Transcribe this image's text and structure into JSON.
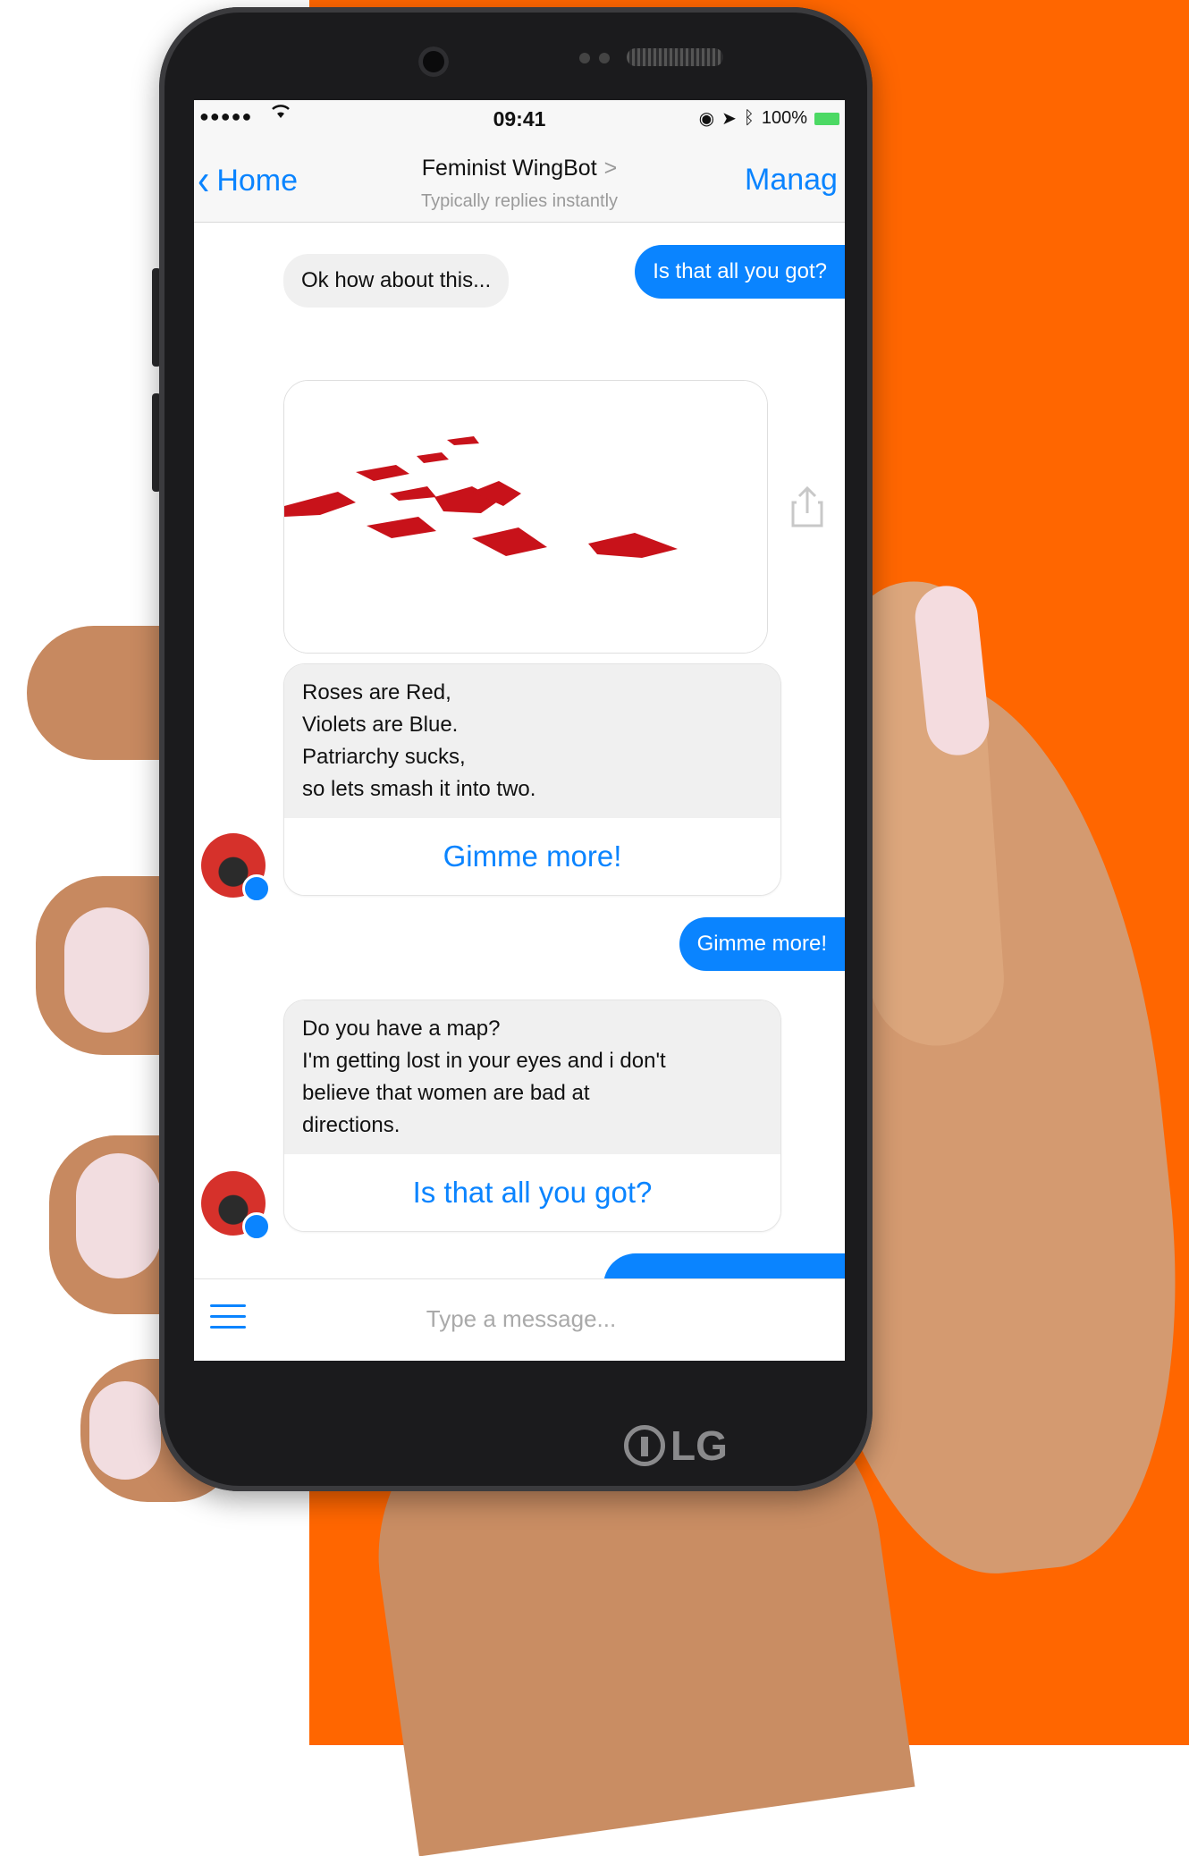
{
  "status_bar": {
    "signal": "●●●●●",
    "time": "09:41",
    "battery": "100%"
  },
  "header": {
    "back_label": "Home",
    "title": "Feminist WingBot",
    "title_arrow": ">",
    "subtitle": "Typically replies instantly",
    "manage_label": "Manag"
  },
  "messages": {
    "out1": "Is that all you got?",
    "in1": "Ok how about this...",
    "poem_lines": [
      "Roses are Red,",
      "Violets are Blue.",
      "Patriarchy sucks,",
      "so lets smash it into two."
    ],
    "poem_button": "Gimme more!",
    "out2": "Gimme more!",
    "pickup_lines": [
      "Do you have a map?",
      "I'm getting lost in your eyes and i don't",
      "believe that women are bad at",
      "directions."
    ],
    "pickup_button": "Is that all you got?"
  },
  "composer": {
    "placeholder": "Type a message..."
  },
  "device": {
    "brand": "LG"
  },
  "colors": {
    "accent": "#0a84ff",
    "background_panel": "#ff6600",
    "bubble_gray": "#f0f0f0"
  },
  "icons": [
    "wifi-icon",
    "back-chevron-icon",
    "share-icon",
    "menu-icon",
    "messenger-badge-icon",
    "battery-icon"
  ]
}
